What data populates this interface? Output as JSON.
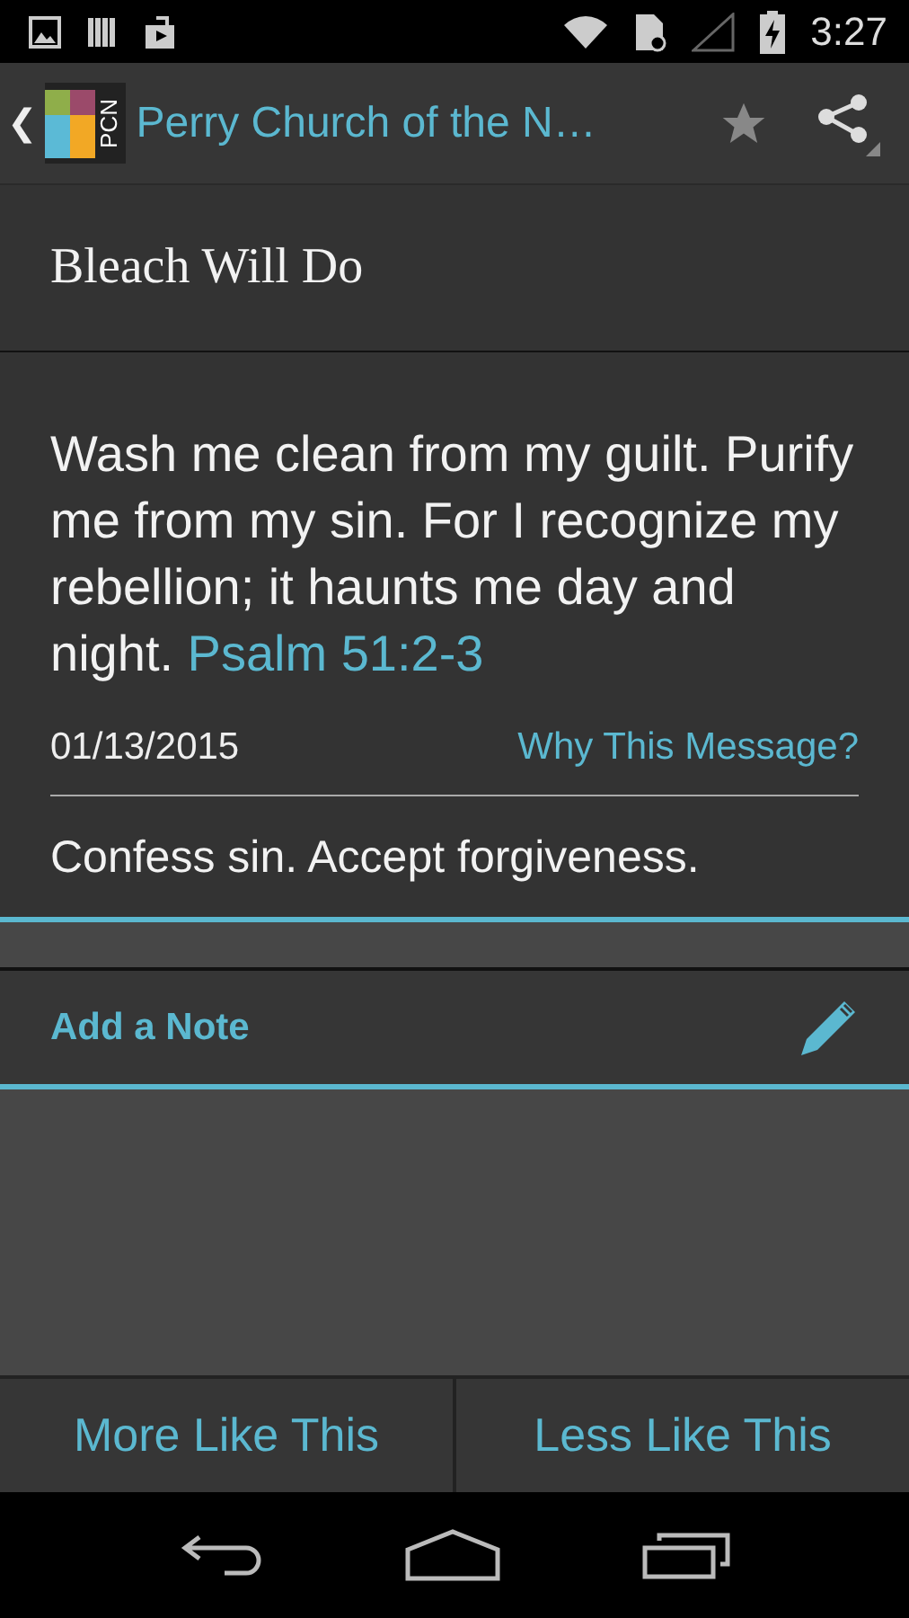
{
  "status_bar": {
    "time": "3:27"
  },
  "action_bar": {
    "back": "❮",
    "logo_text": "PCN",
    "title": "Perry Church of the N…",
    "starred": false
  },
  "message": {
    "title": "Bleach Will Do",
    "verse_text": "Wash me clean from my guilt. Purify me from my sin. For I recognize my rebellion; it haunts me day and night.",
    "verse_ref": "Psalm 51:2-3",
    "date": "01/13/2015",
    "why_link": "Why This Message?",
    "takeaway": "Confess sin. Accept forgiveness."
  },
  "note": {
    "label": "Add a Note"
  },
  "buttons": [
    "More Like This",
    "Less Like This"
  ]
}
